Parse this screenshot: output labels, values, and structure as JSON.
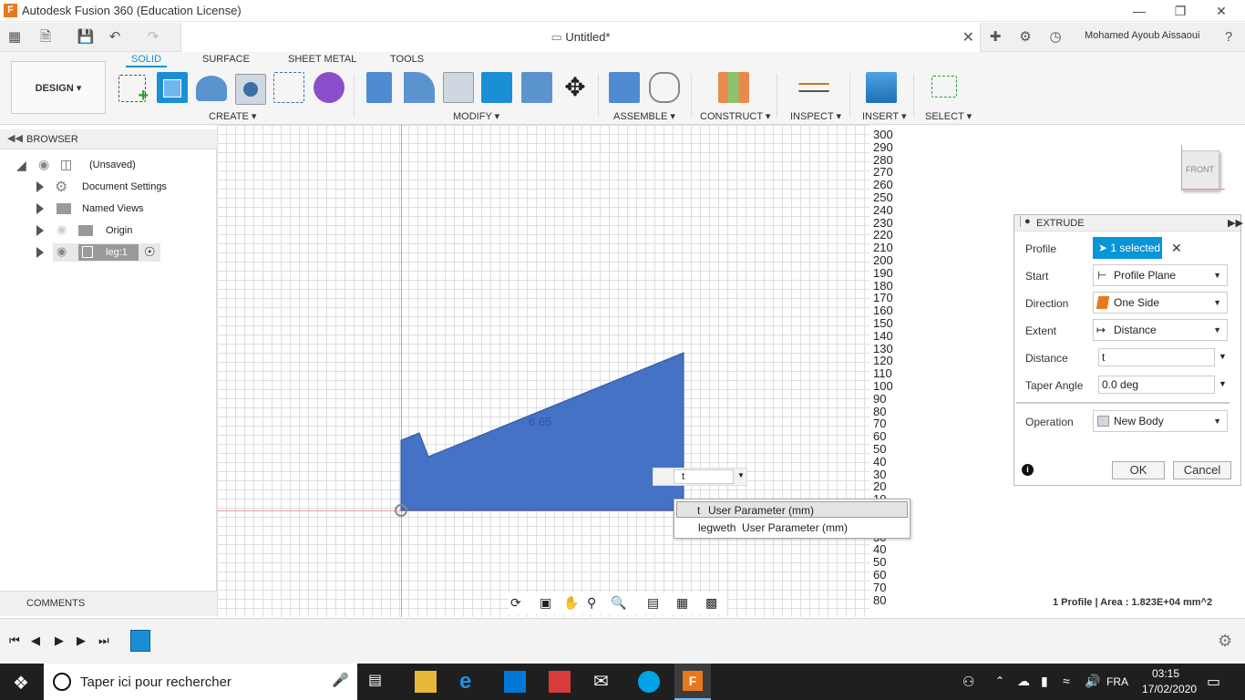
{
  "window": {
    "title": "Autodesk Fusion 360 (Education License)",
    "logo_letter": "F"
  },
  "doc_tab": {
    "name": "Untitled*"
  },
  "user": {
    "name": "Mohamed Ayoub Aissaoui"
  },
  "ribbon": {
    "workspace": "DESIGN",
    "tabs": [
      "SOLID",
      "SURFACE",
      "SHEET METAL",
      "TOOLS"
    ],
    "groups": [
      "CREATE ▾",
      "MODIFY ▾",
      "ASSEMBLE ▾",
      "CONSTRUCT ▾",
      "INSPECT ▾",
      "INSERT ▾",
      "SELECT ▾"
    ]
  },
  "browser": {
    "title": "BROWSER",
    "items": [
      {
        "label": "(Unsaved)"
      },
      {
        "label": "Document Settings"
      },
      {
        "label": "Named Views"
      },
      {
        "label": "Origin"
      },
      {
        "label": "leg:1"
      }
    ],
    "comments": "COMMENTS"
  },
  "canvas": {
    "dimension_label": "6.65",
    "input_value": "t",
    "suggestions": [
      {
        "name": "t",
        "type": "User Parameter (mm)"
      },
      {
        "name": "legweth",
        "type": "User Parameter (mm)"
      }
    ]
  },
  "ruler": {
    "labels": [
      "300",
      "290",
      "280",
      "270",
      "260",
      "250",
      "240",
      "230",
      "220",
      "210",
      "200",
      "190",
      "180",
      "170",
      "160",
      "150",
      "140",
      "130",
      "120",
      "110",
      "100",
      "90",
      "80",
      "70",
      "60",
      "50",
      "40",
      "30",
      "20",
      "10",
      "",
      "",
      "30",
      "40",
      "50",
      "60",
      "70",
      "80"
    ]
  },
  "viewcube": {
    "face": "FRONT"
  },
  "extrude": {
    "title": "EXTRUDE",
    "rows": [
      {
        "label": "Profile",
        "value": "1 selected"
      },
      {
        "label": "Start",
        "value": "Profile Plane"
      },
      {
        "label": "Direction",
        "value": "One Side"
      },
      {
        "label": "Extent",
        "value": "Distance"
      },
      {
        "label": "Distance",
        "value": "t"
      },
      {
        "label": "Taper Angle",
        "value": "0.0 deg"
      },
      {
        "label": "Operation",
        "value": "New Body"
      }
    ],
    "ok": "OK",
    "cancel": "Cancel"
  },
  "status": {
    "text": "1 Profile | Area : 1.823E+04 mm^2"
  },
  "taskbar": {
    "search_placeholder": "Taper ici pour rechercher",
    "language": "FRA",
    "time": "03:15",
    "date": "17/02/2020"
  },
  "colors": {
    "accent": "#0696d7",
    "sketch_fill": "#4472c4",
    "orange": "#e8781e"
  }
}
